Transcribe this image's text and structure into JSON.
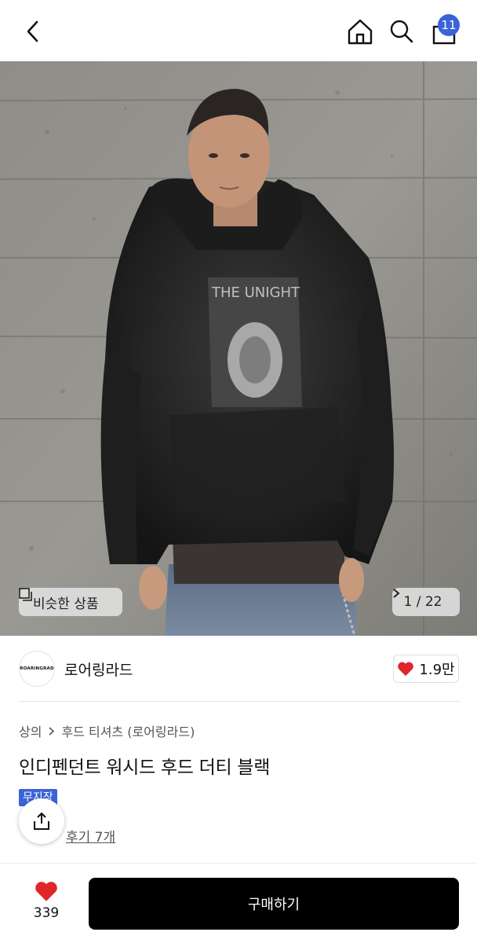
{
  "header": {
    "cart_count": "11",
    "icons": [
      "back-arrow-icon",
      "home-icon",
      "search-icon",
      "shopping-bag-icon"
    ]
  },
  "hero": {
    "similar_label": "비슷한 상품",
    "image_counter": "1 / 22"
  },
  "seller": {
    "logo_text": "ROARINGRAD",
    "name": "로어링라드",
    "likes": "1.9만"
  },
  "product": {
    "breadcrumb": [
      "상의",
      "후드 티셔츠 (로어링라드)"
    ],
    "title": "인디펜던트 워시드 후드 더티 블랙",
    "badge": "무지장",
    "review_link": "후기 7개"
  },
  "footer": {
    "wish_count": "339",
    "buy_label": "구매하기"
  },
  "colors": {
    "accent": "#3b63d8",
    "heart": "#e0262b",
    "buy_button": "#000000"
  }
}
